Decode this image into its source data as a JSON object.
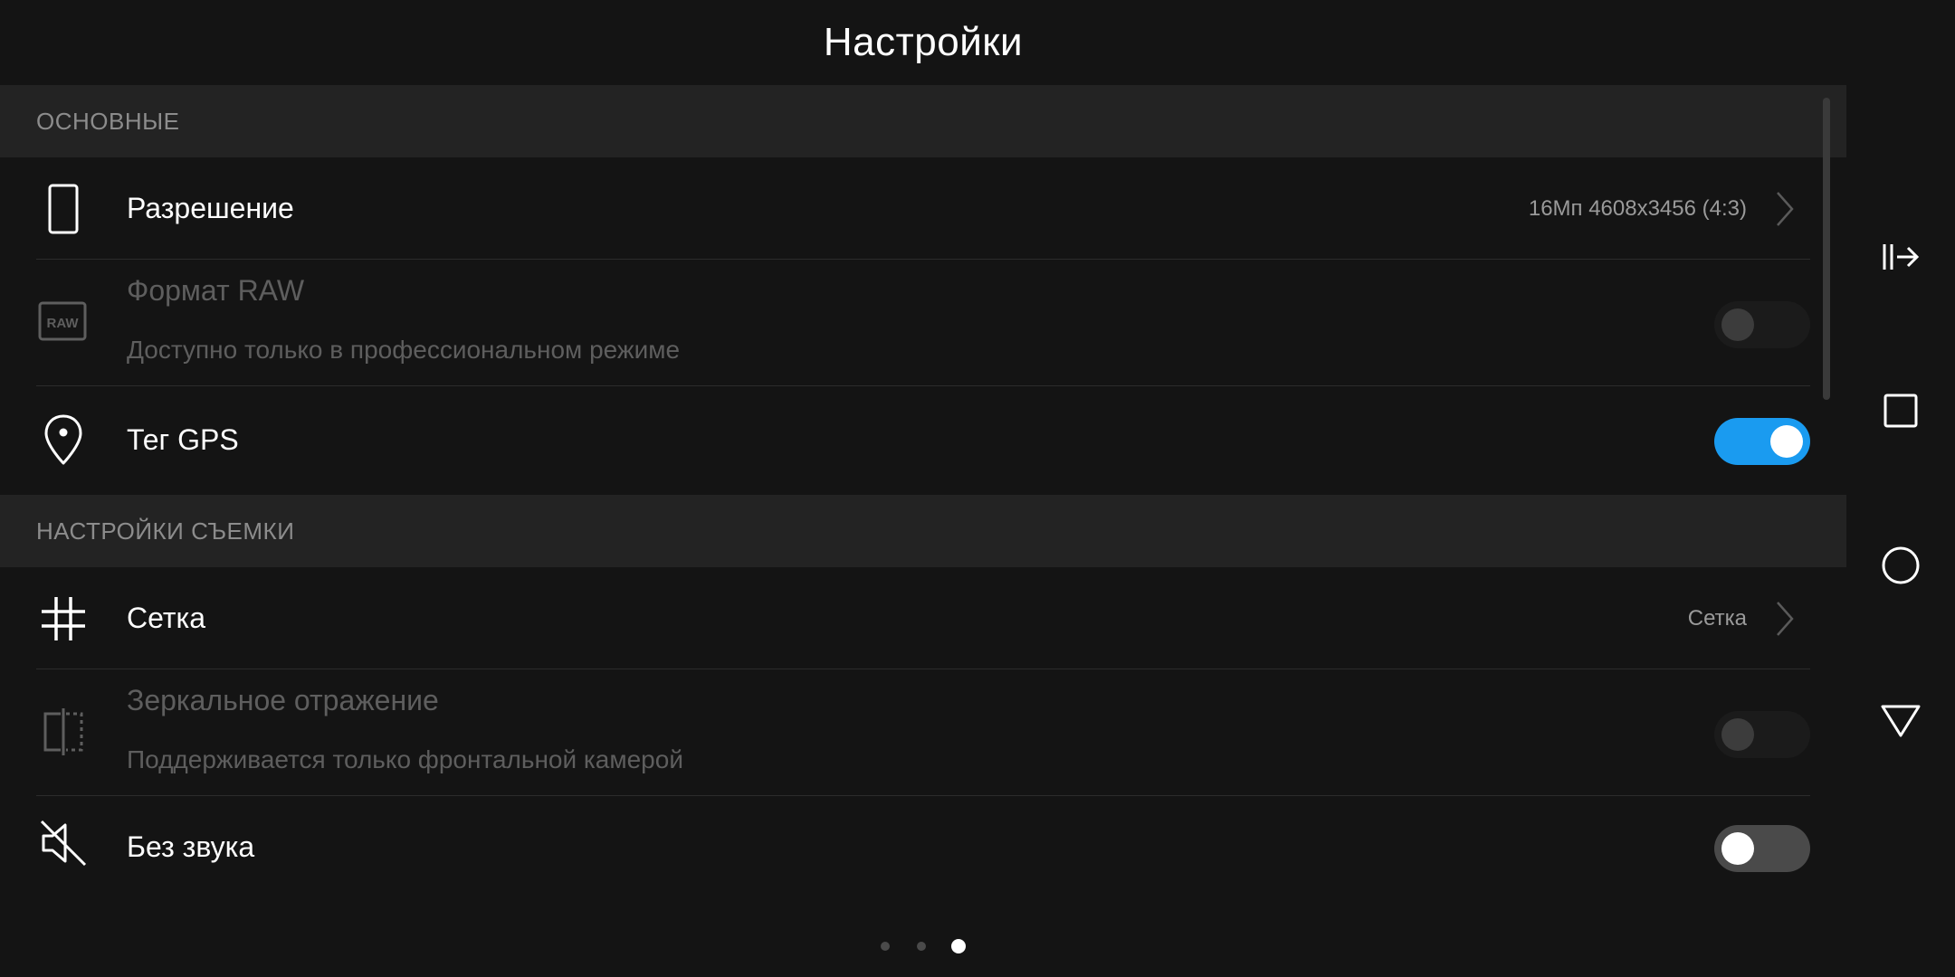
{
  "header": {
    "title": "Настройки"
  },
  "sections": {
    "general": {
      "title": "ОСНОВНЫЕ",
      "resolution": {
        "label": "Разрешение",
        "value": "16Мп 4608x3456 (4:3)",
        "icon": "tablet-icon"
      },
      "raw": {
        "label": "Формат RAW",
        "sublabel": "Доступно только в профессиональном режиме",
        "icon": "raw-icon",
        "enabled": false,
        "checked": false
      },
      "gps": {
        "label": "Тег GPS",
        "icon": "location-pin-icon",
        "enabled": true,
        "checked": true
      }
    },
    "shooting": {
      "title": "НАСТРОЙКИ СЪЕМКИ",
      "grid": {
        "label": "Сетка",
        "value": "Сетка",
        "icon": "grid-icon"
      },
      "mirror": {
        "label": "Зеркальное отражение",
        "sublabel": "Поддерживается только фронтальной камерой",
        "icon": "mirror-icon",
        "enabled": false,
        "checked": false
      },
      "mute": {
        "label": "Без звука",
        "icon": "mute-icon",
        "enabled": true,
        "checked": false
      }
    }
  },
  "page_indicator": {
    "count": 3,
    "active": 3
  },
  "navbar": {
    "buttons": [
      "dock-icon",
      "recents-icon",
      "home-icon",
      "back-icon"
    ]
  },
  "colors": {
    "accent": "#1a9bf0",
    "background": "#141414",
    "section_bg": "#232323"
  }
}
